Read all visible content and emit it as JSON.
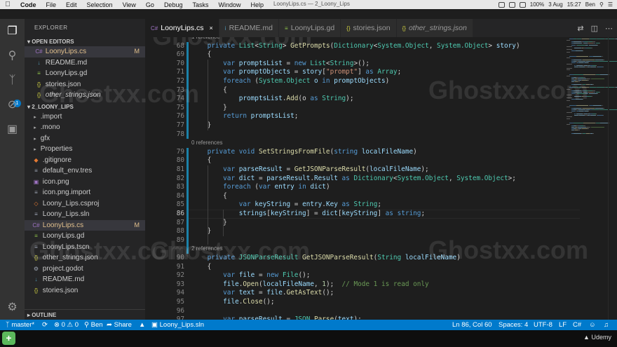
{
  "menubar": {
    "app": "Code",
    "items": [
      "File",
      "Edit",
      "Selection",
      "View",
      "Go",
      "Debug",
      "Tasks",
      "Window",
      "Help"
    ],
    "window_title": "LoonyLips.cs — 2_Loony_Lips",
    "battery": "100%",
    "date": "3 Aug",
    "time": "15:27",
    "user": "Ben"
  },
  "sidebar": {
    "title": "EXPLORER",
    "open_editors_label": "OPEN EDITORS",
    "open_editors": [
      {
        "name": "LoonyLips.cs",
        "icon": "csharp-icon",
        "modified": "M",
        "selected": true
      },
      {
        "name": "README.md",
        "icon": "markdown-icon"
      },
      {
        "name": "LoonyLips.gd",
        "icon": "gdscript-icon"
      },
      {
        "name": "stories.json",
        "icon": "json-icon"
      },
      {
        "name": "other_strings.json",
        "icon": "json-icon",
        "italic": true
      }
    ],
    "project_label": "2_LOONY_LIPS",
    "files": [
      {
        "name": ".import",
        "folder": true
      },
      {
        "name": ".mono",
        "folder": true
      },
      {
        "name": "gfx",
        "folder": true
      },
      {
        "name": "Properties",
        "folder": true
      },
      {
        "name": ".gitignore",
        "icon": "git-icon"
      },
      {
        "name": "default_env.tres",
        "icon": "file-icon"
      },
      {
        "name": "icon.png",
        "icon": "image-icon"
      },
      {
        "name": "icon.png.import",
        "icon": "file-icon"
      },
      {
        "name": "Loony_Lips.csproj",
        "icon": "xml-icon"
      },
      {
        "name": "Loony_Lips.sln",
        "icon": "file-icon"
      },
      {
        "name": "LoonyLips.cs",
        "icon": "csharp-icon",
        "modified": "M",
        "selected": true
      },
      {
        "name": "LoonyLips.gd",
        "icon": "gdscript-icon"
      },
      {
        "name": "LoonyLips.tscn",
        "icon": "file-icon"
      },
      {
        "name": "other_strings.json",
        "icon": "json-icon"
      },
      {
        "name": "project.godot",
        "icon": "gear-icon"
      },
      {
        "name": "README.md",
        "icon": "markdown-icon"
      },
      {
        "name": "stories.json",
        "icon": "json-icon"
      }
    ],
    "outline_label": "OUTLINE",
    "scm_badge": "1"
  },
  "tabs": [
    {
      "label": "LoonyLips.cs",
      "icon": "C#",
      "active": true
    },
    {
      "label": "README.md",
      "icon": "i"
    },
    {
      "label": "LoonyLips.gd",
      "icon": "≡"
    },
    {
      "label": "stories.json",
      "icon": "{}"
    },
    {
      "label": "other_strings.json",
      "icon": "{}",
      "italic": true
    }
  ],
  "editor": {
    "current_line": 86,
    "lines": [
      {
        "type": "lens",
        "text": "1 reference",
        "partial": true
      },
      {
        "n": 68,
        "tokens": [
          [
            "    ",
            "pl"
          ],
          [
            "private",
            "kw"
          ],
          [
            " List",
            "ty"
          ],
          [
            "<",
            "pl"
          ],
          [
            "String",
            "ty"
          ],
          [
            ">",
            "pl"
          ],
          [
            " GetPrompts",
            "fn"
          ],
          [
            "(",
            "pl"
          ],
          [
            "Dictionary",
            "ty"
          ],
          [
            "<",
            "pl"
          ],
          [
            "System.Object",
            "ty"
          ],
          [
            ", ",
            "pl"
          ],
          [
            "System.Object",
            "ty"
          ],
          [
            "> ",
            "pl"
          ],
          [
            "story",
            "vr"
          ],
          [
            ")",
            "pl"
          ]
        ]
      },
      {
        "n": 69,
        "tokens": [
          [
            "    {",
            "pl"
          ]
        ]
      },
      {
        "n": 70,
        "tokens": [
          [
            "        ",
            "pl"
          ],
          [
            "var",
            "kw"
          ],
          [
            " promptsList",
            "vr"
          ],
          [
            " = ",
            "pl"
          ],
          [
            "new",
            "kw"
          ],
          [
            " List",
            "ty"
          ],
          [
            "<",
            "pl"
          ],
          [
            "String",
            "ty"
          ],
          [
            ">();",
            "pl"
          ]
        ]
      },
      {
        "n": 71,
        "tokens": [
          [
            "        ",
            "pl"
          ],
          [
            "var",
            "kw"
          ],
          [
            " promptObjects",
            "vr"
          ],
          [
            " = ",
            "pl"
          ],
          [
            "story",
            "vr"
          ],
          [
            "[",
            "pl"
          ],
          [
            "\"prompt\"",
            "st"
          ],
          [
            "] ",
            "pl"
          ],
          [
            "as",
            "kw"
          ],
          [
            " Array",
            "ty"
          ],
          [
            ";",
            "pl"
          ]
        ]
      },
      {
        "n": 72,
        "tokens": [
          [
            "        ",
            "pl"
          ],
          [
            "foreach",
            "kw"
          ],
          [
            " (",
            "pl"
          ],
          [
            "System.Object",
            "ty"
          ],
          [
            " o ",
            "vr"
          ],
          [
            "in",
            "kw"
          ],
          [
            " promptObjects",
            "vr"
          ],
          [
            ")",
            "pl"
          ]
        ]
      },
      {
        "n": 73,
        "tokens": [
          [
            "        {",
            "pl"
          ]
        ]
      },
      {
        "n": 74,
        "tokens": [
          [
            "            ",
            "pl"
          ],
          [
            "promptsList",
            "vr"
          ],
          [
            ".",
            "pl"
          ],
          [
            "Add",
            "fn"
          ],
          [
            "(o ",
            "pl"
          ],
          [
            "as",
            "kw"
          ],
          [
            " String",
            "ty"
          ],
          [
            ");",
            "pl"
          ]
        ]
      },
      {
        "n": 75,
        "tokens": [
          [
            "        }",
            "pl"
          ]
        ]
      },
      {
        "n": 76,
        "tokens": [
          [
            "        ",
            "pl"
          ],
          [
            "return",
            "kw"
          ],
          [
            " promptsList",
            "vr"
          ],
          [
            ";",
            "pl"
          ]
        ]
      },
      {
        "n": 77,
        "tokens": [
          [
            "    }",
            "pl"
          ]
        ]
      },
      {
        "n": 78,
        "tokens": []
      },
      {
        "type": "lens",
        "text": "0 references"
      },
      {
        "n": 79,
        "tokens": [
          [
            "    ",
            "pl"
          ],
          [
            "private",
            "kw"
          ],
          [
            " void",
            "kw"
          ],
          [
            " SetStringsFromFile",
            "fn"
          ],
          [
            "(",
            "pl"
          ],
          [
            "string",
            "kw"
          ],
          [
            " localFileName",
            "vr"
          ],
          [
            ")",
            "pl"
          ]
        ]
      },
      {
        "n": 80,
        "tokens": [
          [
            "    {",
            "pl"
          ]
        ]
      },
      {
        "n": 81,
        "tokens": [
          [
            "        ",
            "pl"
          ],
          [
            "var",
            "kw"
          ],
          [
            " parseResult",
            "vr"
          ],
          [
            " = ",
            "pl"
          ],
          [
            "GetJSONParseResult",
            "fn"
          ],
          [
            "(",
            "pl"
          ],
          [
            "localFileName",
            "vr"
          ],
          [
            ");",
            "pl"
          ]
        ]
      },
      {
        "n": 82,
        "tokens": [
          [
            "        ",
            "pl"
          ],
          [
            "var",
            "kw"
          ],
          [
            " dict",
            "vr"
          ],
          [
            " = ",
            "pl"
          ],
          [
            "parseResult",
            "vr"
          ],
          [
            ".",
            "pl"
          ],
          [
            "Result",
            "vr"
          ],
          [
            " as ",
            "kw"
          ],
          [
            "Dictionary",
            "ty"
          ],
          [
            "<",
            "pl"
          ],
          [
            "System.Object",
            "ty"
          ],
          [
            ", ",
            "pl"
          ],
          [
            "System.Object",
            "ty"
          ],
          [
            ">;",
            "pl"
          ]
        ]
      },
      {
        "n": 83,
        "tokens": [
          [
            "        ",
            "pl"
          ],
          [
            "foreach",
            "kw"
          ],
          [
            " (",
            "pl"
          ],
          [
            "var",
            "kw"
          ],
          [
            " entry ",
            "vr"
          ],
          [
            "in",
            "kw"
          ],
          [
            " dict",
            "vr"
          ],
          [
            ")",
            "pl"
          ]
        ]
      },
      {
        "n": 84,
        "tokens": [
          [
            "        {",
            "pl"
          ]
        ]
      },
      {
        "n": 85,
        "tokens": [
          [
            "            ",
            "pl"
          ],
          [
            "var",
            "kw"
          ],
          [
            " keyString",
            "vr"
          ],
          [
            " = ",
            "pl"
          ],
          [
            "entry",
            "vr"
          ],
          [
            ".",
            "pl"
          ],
          [
            "Key",
            "vr"
          ],
          [
            " as ",
            "kw"
          ],
          [
            "String",
            "ty"
          ],
          [
            ";",
            "pl"
          ]
        ]
      },
      {
        "n": 86,
        "tokens": [
          [
            "            ",
            "pl"
          ],
          [
            "strings",
            "vr"
          ],
          [
            "[",
            "pl"
          ],
          [
            "keyString",
            "vr"
          ],
          [
            "] = ",
            "pl"
          ],
          [
            "dict",
            "vr"
          ],
          [
            "[",
            "pl"
          ],
          [
            "keyString",
            "vr"
          ],
          [
            "] ",
            "pl"
          ],
          [
            "as",
            "kw"
          ],
          [
            " string",
            "kw"
          ],
          [
            ";",
            "pl"
          ]
        ]
      },
      {
        "n": 87,
        "tokens": [
          [
            "        }",
            "pl"
          ]
        ]
      },
      {
        "n": 88,
        "tokens": [
          [
            "    }",
            "pl"
          ]
        ]
      },
      {
        "n": 89,
        "tokens": []
      },
      {
        "type": "lens",
        "text": "2 references"
      },
      {
        "n": 90,
        "tokens": [
          [
            "    ",
            "pl"
          ],
          [
            "private",
            "kw"
          ],
          [
            " JSONParseResult",
            "ty"
          ],
          [
            " GetJSONParseResult",
            "fn"
          ],
          [
            "(",
            "pl"
          ],
          [
            "String",
            "ty"
          ],
          [
            " localFileName",
            "vr"
          ],
          [
            ")",
            "pl"
          ]
        ]
      },
      {
        "n": 91,
        "tokens": [
          [
            "    {",
            "pl"
          ]
        ]
      },
      {
        "n": 92,
        "tokens": [
          [
            "        ",
            "pl"
          ],
          [
            "var",
            "kw"
          ],
          [
            " file",
            "vr"
          ],
          [
            " = ",
            "pl"
          ],
          [
            "new",
            "kw"
          ],
          [
            " File",
            "ty"
          ],
          [
            "();",
            "pl"
          ]
        ]
      },
      {
        "n": 93,
        "tokens": [
          [
            "        ",
            "pl"
          ],
          [
            "file",
            "vr"
          ],
          [
            ".",
            "pl"
          ],
          [
            "Open",
            "fn"
          ],
          [
            "(",
            "pl"
          ],
          [
            "localFileName",
            "vr"
          ],
          [
            ", ",
            "pl"
          ],
          [
            "1",
            "nu"
          ],
          [
            ");  ",
            "pl"
          ],
          [
            "// Mode 1 is read only",
            "cm"
          ]
        ]
      },
      {
        "n": 94,
        "tokens": [
          [
            "        ",
            "pl"
          ],
          [
            "var",
            "kw"
          ],
          [
            " text",
            "vr"
          ],
          [
            " = ",
            "pl"
          ],
          [
            "file",
            "vr"
          ],
          [
            ".",
            "pl"
          ],
          [
            "GetAsText",
            "fn"
          ],
          [
            "();",
            "pl"
          ]
        ]
      },
      {
        "n": 95,
        "tokens": [
          [
            "        ",
            "pl"
          ],
          [
            "file",
            "vr"
          ],
          [
            ".",
            "pl"
          ],
          [
            "Close",
            "fn"
          ],
          [
            "();",
            "pl"
          ]
        ]
      },
      {
        "n": 96,
        "tokens": []
      },
      {
        "n": 97,
        "tokens": [
          [
            "        ",
            "pl"
          ],
          [
            "var",
            "kw"
          ],
          [
            " parseResult",
            "vr"
          ],
          [
            " = ",
            "pl"
          ],
          [
            "JSON",
            "ty"
          ],
          [
            ".",
            "pl"
          ],
          [
            "Parse",
            "fn"
          ],
          [
            "(",
            "pl"
          ],
          [
            "text",
            "vr"
          ],
          [
            ");",
            "pl"
          ]
        ]
      }
    ]
  },
  "statusbar": {
    "branch": "master*",
    "errors": "0",
    "warnings": "0",
    "user": "Ben",
    "share": "Share",
    "solution": "Loony_Lips.sln",
    "position": "Ln 86, Col 60",
    "spaces": "Spaces: 4",
    "encoding": "UTF-8",
    "eol": "LF",
    "language": "C#"
  },
  "watermark": "Ghostxx.com",
  "dock": {
    "brand": "Udemy"
  },
  "colors": {
    "accent": "#007acc",
    "modified": "#e2c08d",
    "sidebar": "#252526",
    "editor": "#1e1e1e"
  }
}
